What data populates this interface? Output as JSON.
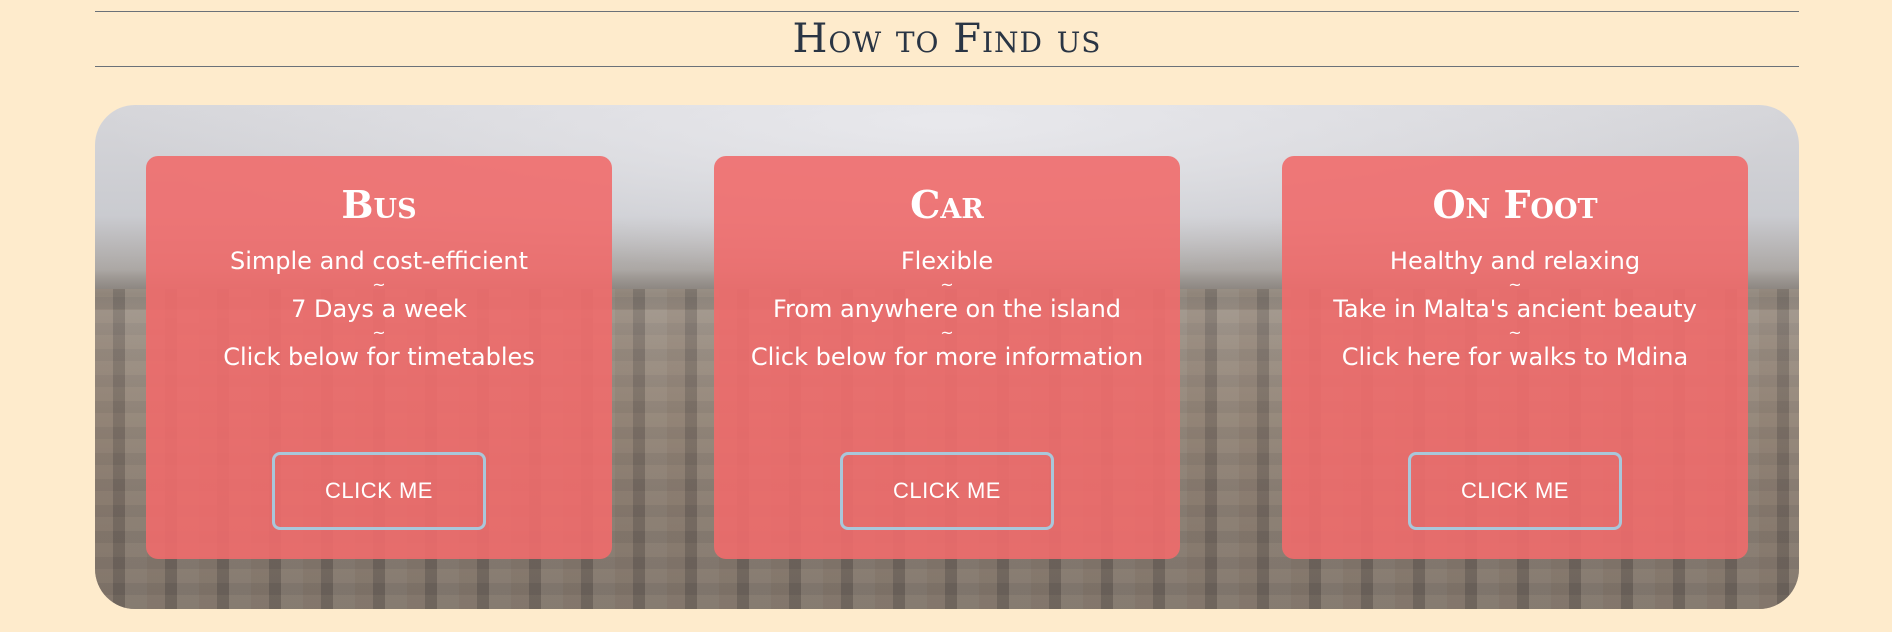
{
  "section": {
    "title": "How to Find us"
  },
  "cards": [
    {
      "title": "Bus",
      "line1": "Simple and cost-efficient",
      "sep1": "~",
      "line2": "7 Days a week",
      "sep2": "~",
      "line3": "Click below for timetables",
      "button": "CLICK ME"
    },
    {
      "title": "Car",
      "line1": "Flexible",
      "sep1": "~",
      "line2": "From anywhere on the island",
      "sep2": "~",
      "line3": "Click below for more information",
      "button": "CLICK ME"
    },
    {
      "title": "On Foot",
      "line1": "Healthy and relaxing",
      "sep1": "~",
      "line2": "Take in Malta's ancient beauty",
      "sep2": "~",
      "line3": "Click here for walks to Mdina",
      "button": "CLICK ME"
    }
  ],
  "colors": {
    "page_background": "#feebcc",
    "card_background": "#f06b6c",
    "button_border": "#a9c7da",
    "heading_text": "#2a3544"
  }
}
